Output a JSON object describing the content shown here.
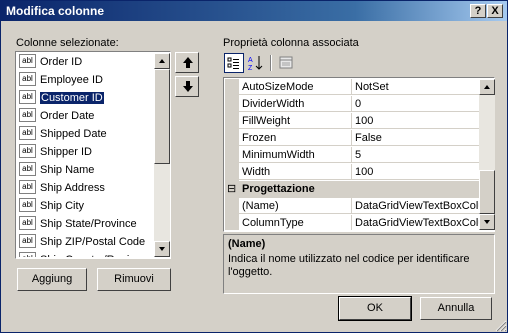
{
  "window": {
    "title": "Modifica colonne",
    "help_label": "?",
    "close_label": "X"
  },
  "columns_panel": {
    "label": "Colonne selezionate:",
    "items": [
      {
        "label": "Order ID",
        "icon": "abl"
      },
      {
        "label": "Employee ID",
        "icon": "abl"
      },
      {
        "label": "Customer ID",
        "icon": "abl",
        "selected": true
      },
      {
        "label": "Order Date",
        "icon": "abl"
      },
      {
        "label": "Shipped Date",
        "icon": "abl"
      },
      {
        "label": "Shipper ID",
        "icon": "abl"
      },
      {
        "label": "Ship Name",
        "icon": "abl"
      },
      {
        "label": "Ship Address",
        "icon": "abl"
      },
      {
        "label": "Ship City",
        "icon": "abl"
      },
      {
        "label": "Ship State/Province",
        "icon": "abl"
      },
      {
        "label": "Ship ZIP/Postal Code",
        "icon": "abl"
      },
      {
        "label": "Ship Country/Region",
        "icon": "abl"
      }
    ],
    "add_label": "Aggiung",
    "remove_label": "Rimuovi"
  },
  "properties_panel": {
    "label": "Proprietà colonna associata",
    "rows": [
      {
        "name": "AutoSizeMode",
        "value": "NotSet"
      },
      {
        "name": "DividerWidth",
        "value": "0"
      },
      {
        "name": "FillWeight",
        "value": "100"
      },
      {
        "name": "Frozen",
        "value": "False"
      },
      {
        "name": "MinimumWidth",
        "value": "5"
      },
      {
        "name": "Width",
        "value": "100"
      }
    ],
    "category": {
      "symbol": "⊟",
      "label": "Progettazione"
    },
    "rows2": [
      {
        "name": "(Name)",
        "value": "DataGridViewTextBoxColu"
      },
      {
        "name": "ColumnType",
        "value": "DataGridViewTextBoxColu"
      }
    ],
    "description": {
      "title": "(Name)",
      "text": "Indica il nome utilizzato nel codice per identificare l'oggetto."
    }
  },
  "footer": {
    "ok_label": "OK",
    "cancel_label": "Annulla"
  }
}
